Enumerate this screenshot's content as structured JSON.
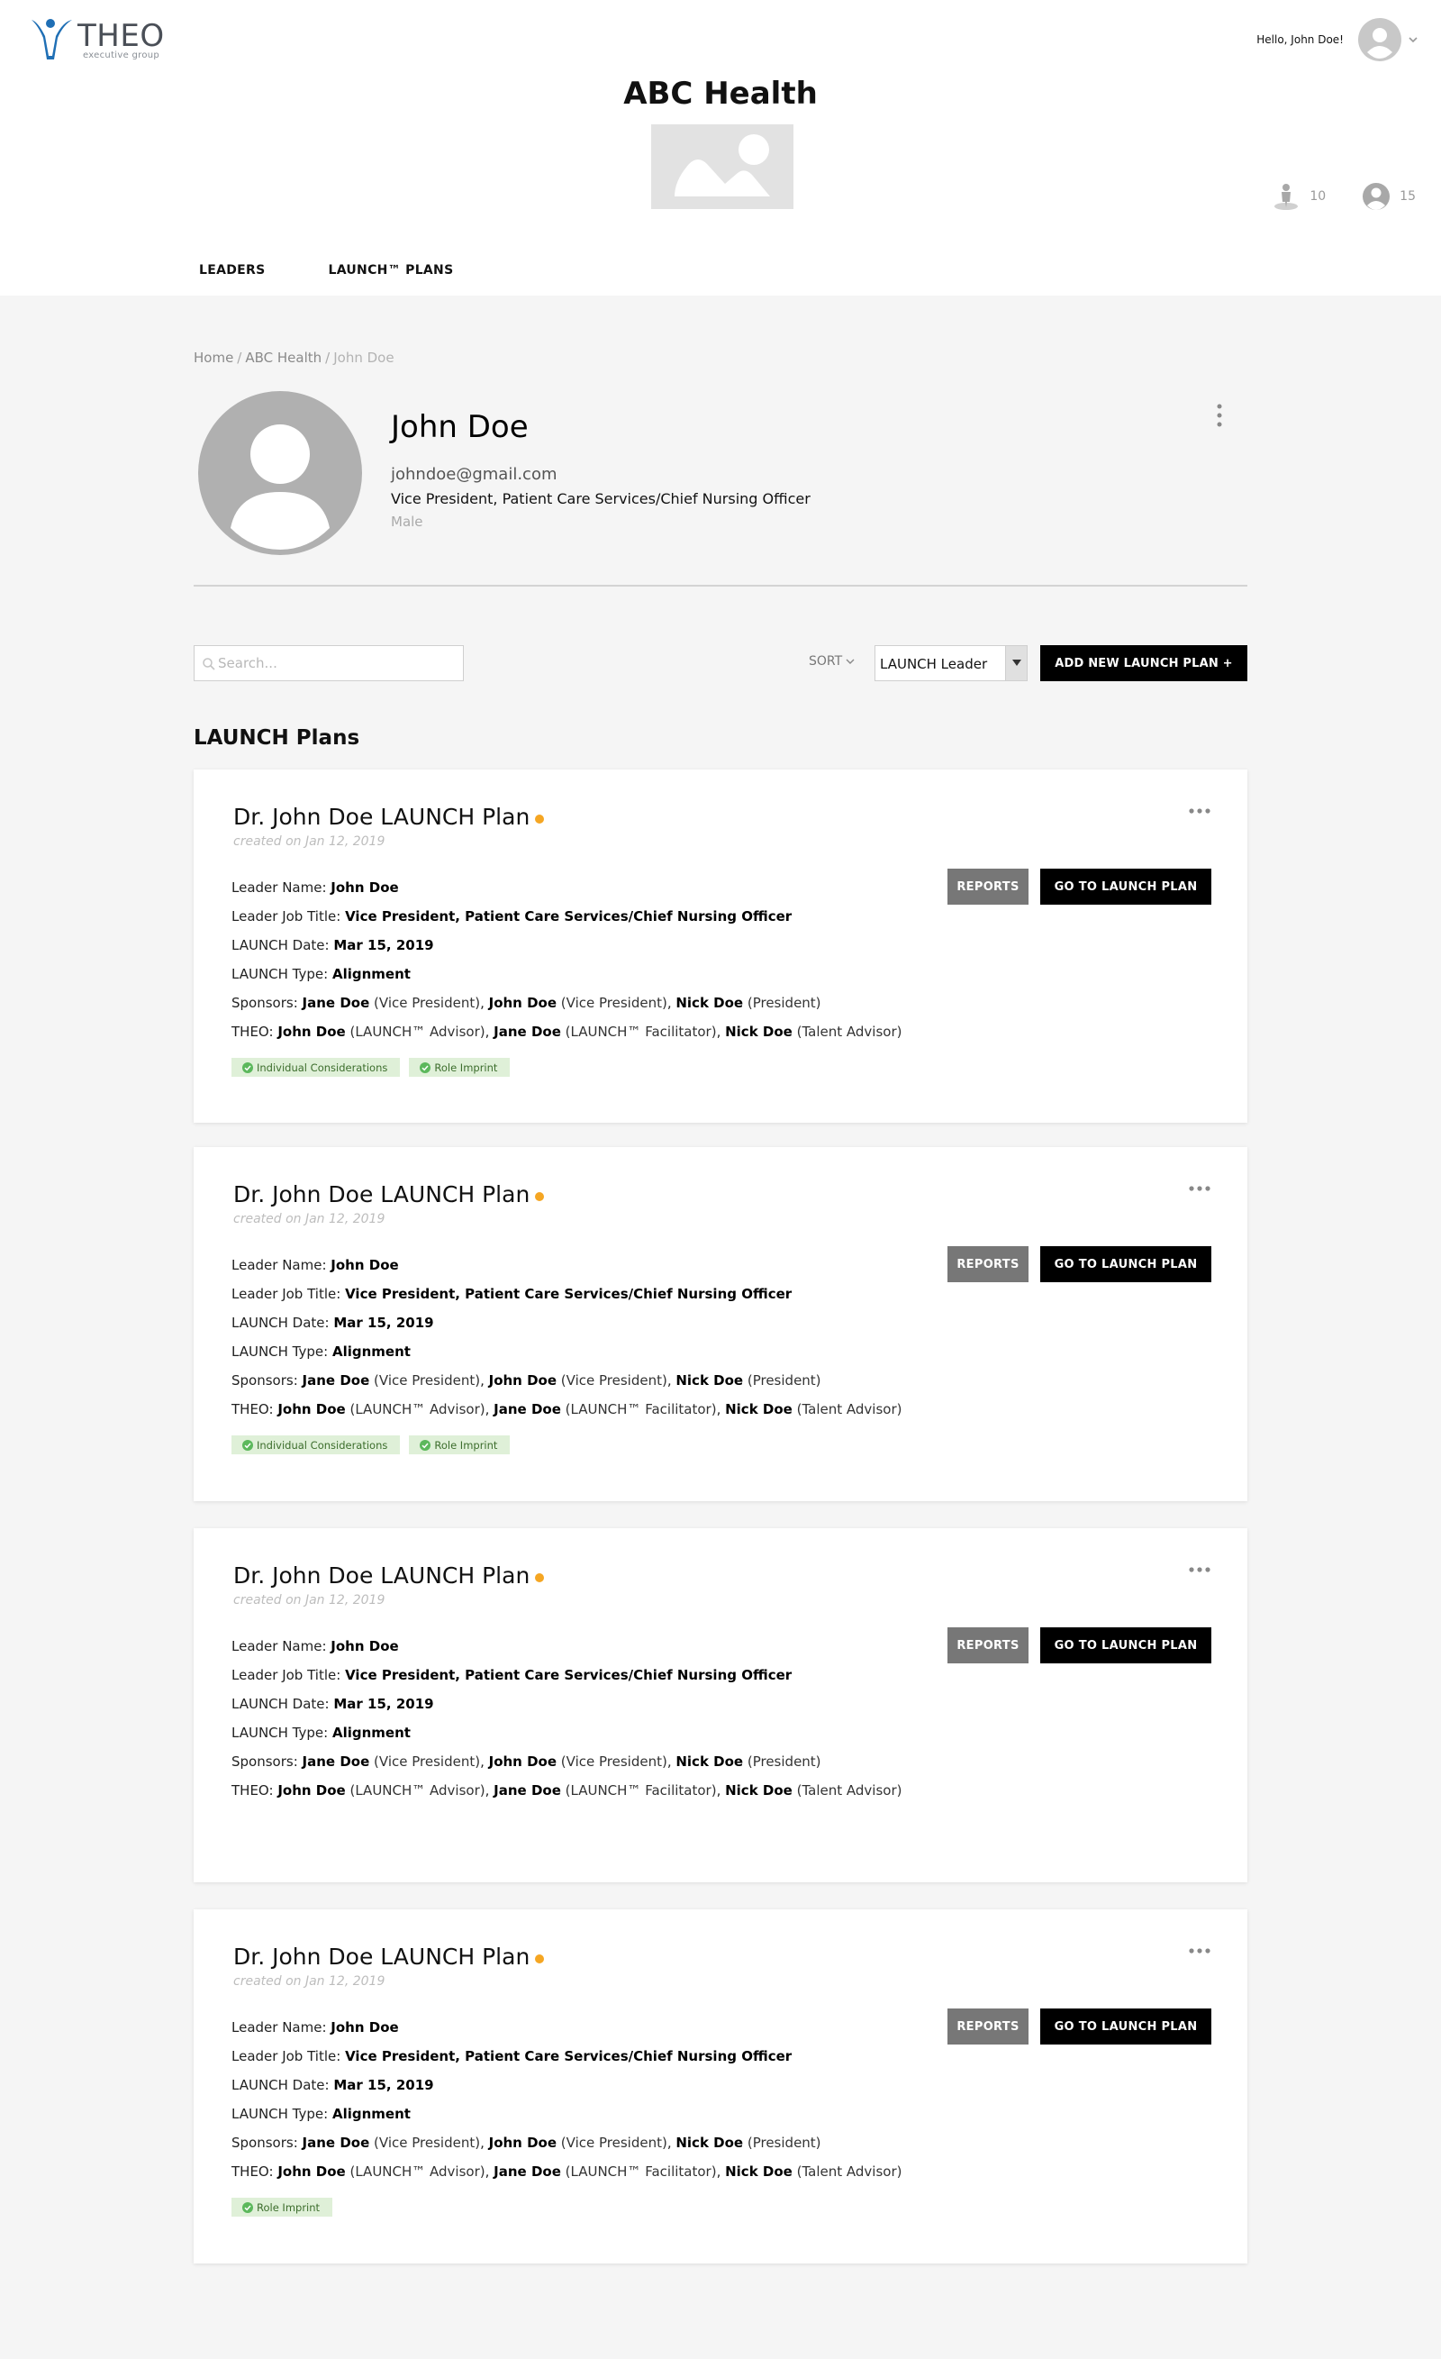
{
  "brand": {
    "logo_word": "THEO",
    "logo_sub": "executive group",
    "logo_color": "#1f6fb5"
  },
  "user_menu": {
    "greeting": "Hello, John Doe!",
    "avatar_icon": "user-avatar-icon",
    "chevron_icon": "chevron-down-icon"
  },
  "org": {
    "name": "ABC Health",
    "logo_icon": "image-placeholder-icon",
    "stats": [
      {
        "icon": "leader-icon",
        "value": "10"
      },
      {
        "icon": "user-circle-icon",
        "value": "15"
      }
    ]
  },
  "nav": {
    "items": [
      {
        "label": "LEADERS"
      },
      {
        "label": "LAUNCH™ PLANS"
      }
    ]
  },
  "breadcrumb": {
    "home": "Home",
    "org": "ABC Health",
    "current": "John Doe",
    "sep": "/"
  },
  "profile": {
    "name": "John Doe",
    "email": "johndoe@gmail.com",
    "title": "Vice President, Patient Care Services/Chief Nursing Officer",
    "gender": "Male"
  },
  "controls": {
    "search_placeholder": "Search...",
    "sort_label": "SORT",
    "sort_value": "LAUNCH Leader",
    "add_button": "ADD NEW LAUNCH PLAN +"
  },
  "section_title": "LAUNCH Plans",
  "colors": {
    "status_dot": "#f5a623",
    "tag_bg": "#dff0d8",
    "tag_check": "#5cb85c"
  },
  "plans": [
    {
      "title": "Dr. John Doe LAUNCH Plan",
      "created": "created on Jan 12, 2019",
      "reports_label": "REPORTS",
      "goto_label": "GO TO LAUNCH PLAN",
      "leader_name_label": "Leader Name:",
      "leader_name": "John Doe",
      "job_title_label": "Leader Job Title:",
      "job_title": "Vice President, Patient Care Services/Chief Nursing Officer",
      "date_label": "LAUNCH Date:",
      "date": "Mar 15, 2019",
      "type_label": "LAUNCH Type:",
      "type": "Alignment",
      "sponsors_label": "Sponsors:",
      "sponsors": [
        {
          "name": "Jane Doe",
          "role": "(Vice President)"
        },
        {
          "name": "John Doe",
          "role": "(Vice President)"
        },
        {
          "name": "Nick Doe",
          "role": "(President)"
        }
      ],
      "theo_label": "THEO:",
      "theo": [
        {
          "name": "John Doe",
          "role": "(LAUNCH™ Advisor)"
        },
        {
          "name": "Jane Doe",
          "role": "(LAUNCH™ Facilitator)"
        },
        {
          "name": "Nick Doe",
          "role": "(Talent Advisor)"
        }
      ],
      "tags": [
        "Individual Considerations",
        "Role Imprint"
      ]
    },
    {
      "title": "Dr. John Doe LAUNCH Plan",
      "created": "created on Jan 12, 2019",
      "reports_label": "REPORTS",
      "goto_label": "GO TO LAUNCH PLAN",
      "leader_name_label": "Leader Name:",
      "leader_name": "John Doe",
      "job_title_label": "Leader Job Title:",
      "job_title": "Vice President, Patient Care Services/Chief Nursing Officer",
      "date_label": "LAUNCH Date:",
      "date": "Mar 15, 2019",
      "type_label": "LAUNCH Type:",
      "type": "Alignment",
      "sponsors_label": "Sponsors:",
      "sponsors": [
        {
          "name": "Jane Doe",
          "role": "(Vice President)"
        },
        {
          "name": "John Doe",
          "role": "(Vice President)"
        },
        {
          "name": "Nick Doe",
          "role": "(President)"
        }
      ],
      "theo_label": "THEO:",
      "theo": [
        {
          "name": "John Doe",
          "role": "(LAUNCH™ Advisor)"
        },
        {
          "name": "Jane Doe",
          "role": "(LAUNCH™ Facilitator)"
        },
        {
          "name": "Nick Doe",
          "role": "(Talent Advisor)"
        }
      ],
      "tags": [
        "Individual Considerations",
        "Role Imprint"
      ]
    },
    {
      "title": "Dr. John Doe LAUNCH Plan",
      "created": "created on Jan 12, 2019",
      "reports_label": "REPORTS",
      "goto_label": "GO TO LAUNCH PLAN",
      "leader_name_label": "Leader Name:",
      "leader_name": "John Doe",
      "job_title_label": "Leader Job Title:",
      "job_title": "Vice President, Patient Care Services/Chief Nursing Officer",
      "date_label": "LAUNCH Date:",
      "date": "Mar 15, 2019",
      "type_label": "LAUNCH Type:",
      "type": "Alignment",
      "sponsors_label": "Sponsors:",
      "sponsors": [
        {
          "name": "Jane Doe",
          "role": "(Vice President)"
        },
        {
          "name": "John Doe",
          "role": "(Vice President)"
        },
        {
          "name": "Nick Doe",
          "role": "(President)"
        }
      ],
      "theo_label": "THEO:",
      "theo": [
        {
          "name": "John Doe",
          "role": "(LAUNCH™ Advisor)"
        },
        {
          "name": "Jane Doe",
          "role": "(LAUNCH™ Facilitator)"
        },
        {
          "name": "Nick Doe",
          "role": "(Talent Advisor)"
        }
      ],
      "tags": []
    },
    {
      "title": "Dr. John Doe LAUNCH Plan",
      "created": "created on Jan 12, 2019",
      "reports_label": "REPORTS",
      "goto_label": "GO TO LAUNCH PLAN",
      "leader_name_label": "Leader Name:",
      "leader_name": "John Doe",
      "job_title_label": "Leader Job Title:",
      "job_title": "Vice President, Patient Care Services/Chief Nursing Officer",
      "date_label": "LAUNCH Date:",
      "date": "Mar 15, 2019",
      "type_label": "LAUNCH Type:",
      "type": "Alignment",
      "sponsors_label": "Sponsors:",
      "sponsors": [
        {
          "name": "Jane Doe",
          "role": "(Vice President)"
        },
        {
          "name": "John Doe",
          "role": "(Vice President)"
        },
        {
          "name": "Nick Doe",
          "role": "(President)"
        }
      ],
      "theo_label": "THEO:",
      "theo": [
        {
          "name": "John Doe",
          "role": "(LAUNCH™ Advisor)"
        },
        {
          "name": "Jane Doe",
          "role": "(LAUNCH™ Facilitator)"
        },
        {
          "name": "Nick Doe",
          "role": "(Talent Advisor)"
        }
      ],
      "tags": [
        "Role Imprint"
      ]
    }
  ]
}
